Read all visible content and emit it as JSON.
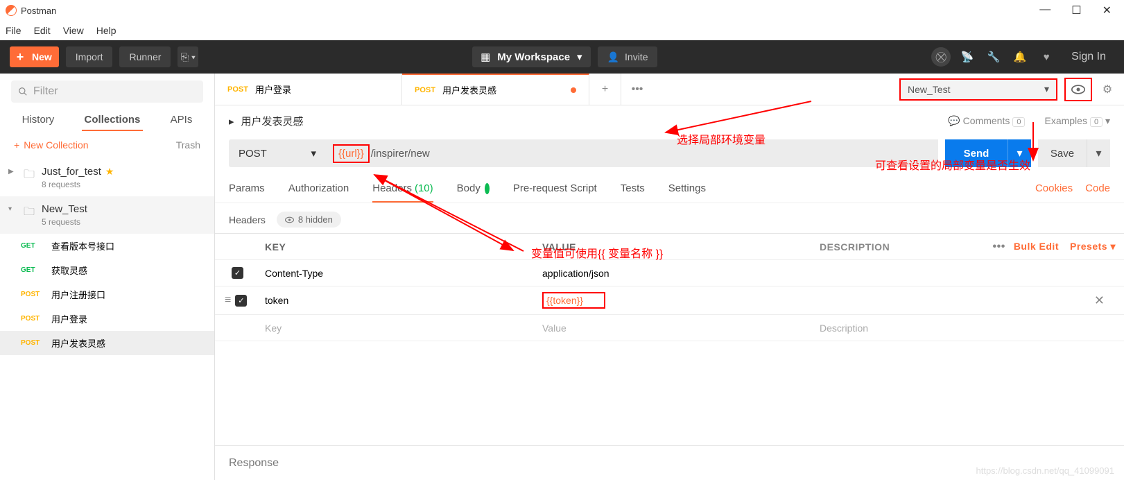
{
  "app": {
    "title": "Postman"
  },
  "menu": {
    "file": "File",
    "edit": "Edit",
    "view": "View",
    "help": "Help"
  },
  "toolbar": {
    "new": "New",
    "import": "Import",
    "runner": "Runner",
    "workspace": "My Workspace",
    "invite": "Invite",
    "signin": "Sign In"
  },
  "sidebar": {
    "filter_placeholder": "Filter",
    "tabs": {
      "history": "History",
      "collections": "Collections",
      "apis": "APIs"
    },
    "new_collection": "New Collection",
    "trash": "Trash",
    "collections": [
      {
        "name": "Just_for_test",
        "sub": "8 requests",
        "starred": true
      },
      {
        "name": "New_Test",
        "sub": "5 requests",
        "starred": false
      }
    ],
    "requests": [
      {
        "method": "GET",
        "m_class": "get",
        "name": "查看版本号接口"
      },
      {
        "method": "GET",
        "m_class": "get",
        "name": "获取灵感"
      },
      {
        "method": "POST",
        "m_class": "post",
        "name": "用户注册接口"
      },
      {
        "method": "POST",
        "m_class": "post",
        "name": "用户登录"
      },
      {
        "method": "POST",
        "m_class": "post",
        "name": "用户发表灵感"
      }
    ]
  },
  "tabs": [
    {
      "method": "POST",
      "name": "用户登录",
      "active": false
    },
    {
      "method": "POST",
      "name": "用户发表灵感",
      "active": true
    }
  ],
  "env": {
    "name": "New_Test"
  },
  "request": {
    "breadcrumb": "用户发表灵感",
    "comments": "Comments",
    "comments_count": "0",
    "examples": "Examples",
    "examples_count": "0",
    "method": "POST",
    "url_var": "{{url}}",
    "url_rest": "/inspirer/new",
    "send": "Send",
    "save": "Save"
  },
  "subtabs": {
    "params": "Params",
    "auth": "Authorization",
    "headers": "Headers",
    "headers_count": "(10)",
    "body": "Body",
    "prereq": "Pre-request Script",
    "tests": "Tests",
    "settings": "Settings",
    "cookies": "Cookies",
    "code": "Code"
  },
  "headers_section": {
    "label": "Headers",
    "hidden": "8 hidden"
  },
  "table": {
    "key_h": "KEY",
    "val_h": "VALUE",
    "desc_h": "DESCRIPTION",
    "bulk": "Bulk Edit",
    "presets": "Presets",
    "rows": [
      {
        "key": "Content-Type",
        "val": "application/json",
        "orange": false
      },
      {
        "key": "token",
        "val": "{{token}}",
        "orange": true
      }
    ],
    "ph_key": "Key",
    "ph_val": "Value",
    "ph_desc": "Description"
  },
  "response": {
    "label": "Response"
  },
  "annot": {
    "a1": "选择局部环境变量",
    "a2": "可查看设置的局部变量是否生效",
    "a3": "变量值可使用{{ 变量名称 }}"
  },
  "watermark": "https://blog.csdn.net/qq_41099091"
}
